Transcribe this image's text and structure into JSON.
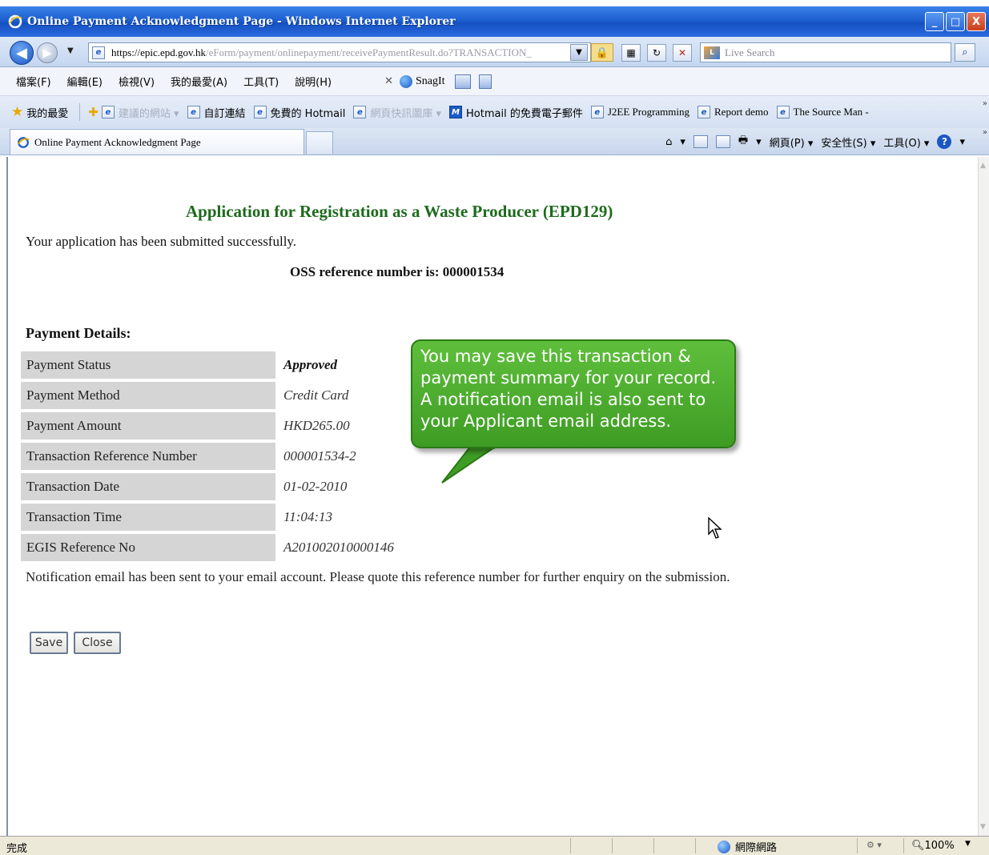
{
  "window": {
    "title": "Online Payment Acknowledgment Page - Windows Internet Explorer",
    "buttons": [
      "_",
      "□",
      "X"
    ]
  },
  "address_bar": {
    "url_host": "https://epic.epd.gov.hk",
    "url_path": "/eForm/payment/onlinepayment/receivePaymentResult.do?TRANSACTION_",
    "search_placeholder": "Live Search"
  },
  "menu": {
    "items": [
      "檔案(F)",
      "編輯(E)",
      "檢視(V)",
      "我的最愛(A)",
      "工具(T)",
      "說明(H)"
    ],
    "snagit": "SnagIt"
  },
  "favorites": {
    "label": "我的最愛",
    "items": [
      "建議的網站 ▾",
      "自訂連結",
      "免費的 Hotmail",
      "網頁快訊圖庫 ▾",
      "Hotmail 的免費電子郵件",
      "J2EE Programming",
      "Report demo",
      "The Source Man -"
    ]
  },
  "tab": {
    "title": "Online Payment Acknowledgment Page",
    "command_bar": [
      "▾",
      "網頁(P) ▾",
      "安全性(S) ▾",
      "工具(O) ▾"
    ]
  },
  "page": {
    "heading": "Application for Registration as a Waste Producer (EPD129)",
    "success_message": "Your application has been submitted successfully.",
    "oss_reference": "OSS reference number is: 000001534",
    "payment_details_title": "Payment Details:",
    "details": [
      {
        "label": "Payment Status",
        "value": "Approved"
      },
      {
        "label": "Payment Method",
        "value": "Credit Card"
      },
      {
        "label": "Payment Amount",
        "value": "HKD265.00"
      },
      {
        "label": "Transaction Reference Number",
        "value": "000001534-2"
      },
      {
        "label": "Transaction Date",
        "value": "01-02-2010"
      },
      {
        "label": "Transaction Time",
        "value": "11:04:13"
      },
      {
        "label": "EGIS Reference No",
        "value": "A201002010000146"
      }
    ],
    "notification": "Notification email has been sent to your email account. Please quote this reference number for further enquiry on the submission.",
    "save_label": "Save",
    "close_label": "Close"
  },
  "callout": {
    "text": "You may save this transaction & payment summary for your record. A notification email is also sent to your Applicant email address."
  },
  "status_bar": {
    "left": "完成",
    "zone": "網際網路",
    "zoom": "100%"
  },
  "colors": {
    "heading_green": "#1d6a1d",
    "callout_green": "#4caf2e",
    "label_bg": "#d5d5d5",
    "titlebar_blue": "#1d5fd0"
  }
}
